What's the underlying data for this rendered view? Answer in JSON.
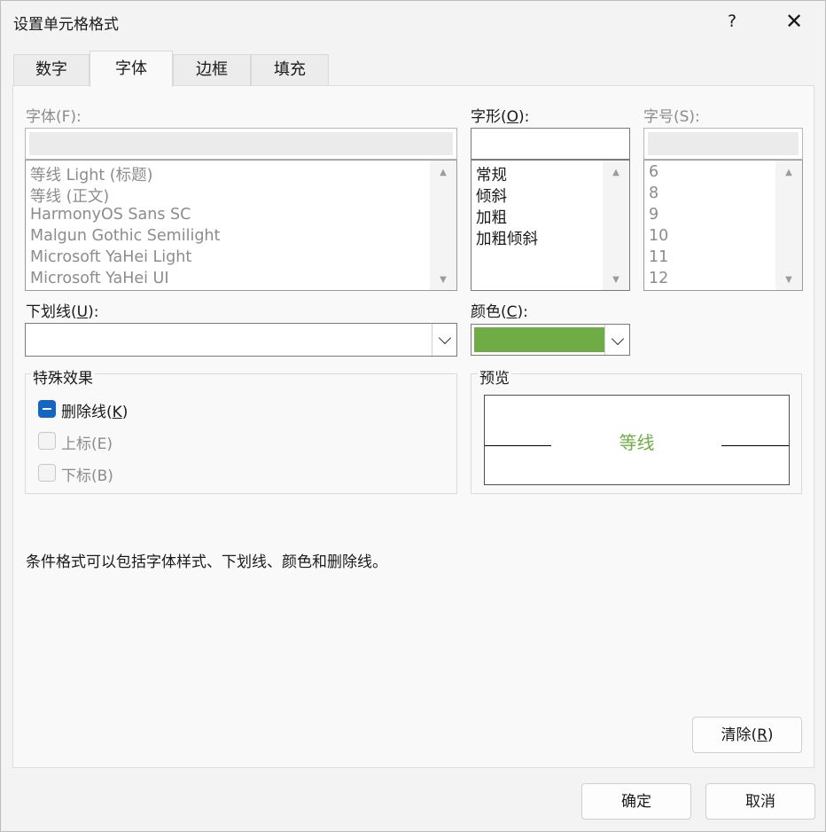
{
  "window": {
    "title": "设置单元格格式",
    "help_label": "?",
    "close_label": "✕"
  },
  "tabs": [
    {
      "label": "数字",
      "active": false
    },
    {
      "label": "字体",
      "active": true
    },
    {
      "label": "边框",
      "active": false
    },
    {
      "label": "填充",
      "active": false
    }
  ],
  "font": {
    "label": "字体(F):",
    "value": "",
    "items": [
      "等线 Light (标题)",
      "等线 (正文)",
      "HarmonyOS Sans SC",
      "Malgun Gothic Semilight",
      "Microsoft YaHei Light",
      "Microsoft YaHei UI"
    ]
  },
  "style": {
    "label_prefix": "字形(",
    "label_key": "O",
    "label_suffix": "):",
    "value": "",
    "items": [
      "常规",
      "倾斜",
      "加粗",
      "加粗倾斜"
    ]
  },
  "size": {
    "label": "字号(S):",
    "value": "",
    "items": [
      "6",
      "8",
      "9",
      "10",
      "11",
      "12"
    ]
  },
  "underline": {
    "label_prefix": "下划线(",
    "label_key": "U",
    "label_suffix": "):",
    "value": ""
  },
  "color": {
    "label_prefix": "颜色(",
    "label_key": "C",
    "label_suffix": "):",
    "swatch": "#6fac46"
  },
  "effects": {
    "title": "特殊效果",
    "strikethrough": {
      "prefix": "删除线(",
      "key": "K",
      "suffix": ")",
      "checked": "indeterminate"
    },
    "superscript": {
      "label": "上标(E)",
      "checked": false
    },
    "subscript": {
      "label": "下标(B)",
      "checked": false
    }
  },
  "preview": {
    "title": "预览",
    "sample": "等线",
    "sample_color": "#6fac46"
  },
  "info_text": "条件格式可以包括字体样式、下划线、颜色和删除线。",
  "buttons": {
    "clear_prefix": "清除(",
    "clear_key": "R",
    "clear_suffix": ")",
    "ok": "确定",
    "cancel": "取消"
  }
}
